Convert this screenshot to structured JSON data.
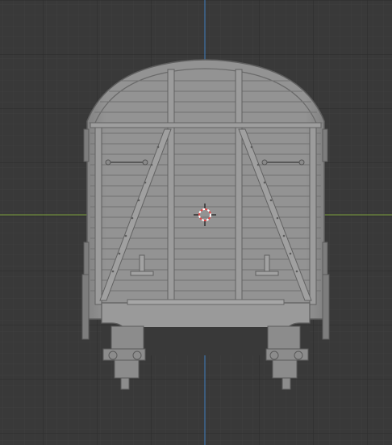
{
  "viewport": {
    "background": "#393939",
    "grid_minor_color": "#404040",
    "grid_major_color": "#2b2b2b",
    "x_axis_color": "#7fa33f",
    "z_axis_color": "#3f7dbd",
    "view": "front-orthographic"
  },
  "object": {
    "type": "mesh",
    "name": "",
    "shading": "solid",
    "body_color": "#8f8f8f",
    "panel_color": "#9a9a9a",
    "edge_color": "#5e5e5e"
  },
  "cursor": {
    "icon": "3d-cursor-icon",
    "ring_color_a": "#e04b4b",
    "ring_color_b": "#ffffff"
  }
}
